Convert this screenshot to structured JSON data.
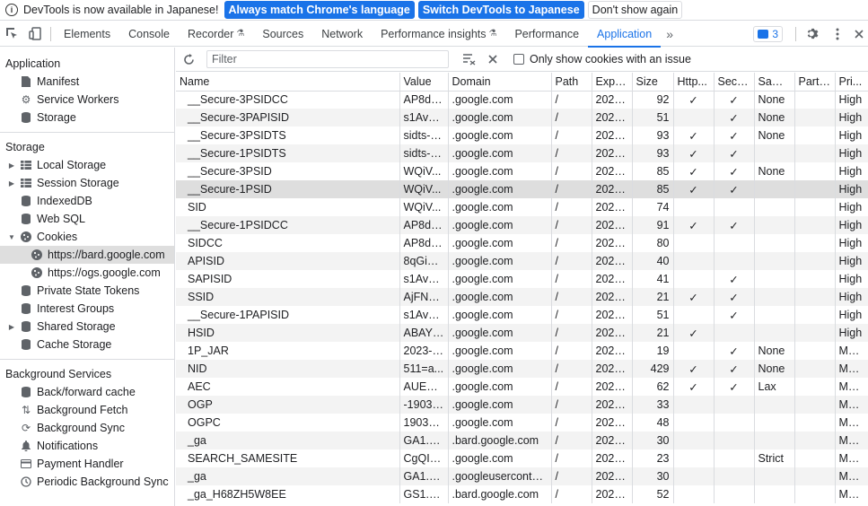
{
  "infobar": {
    "message": "DevTools is now available in Japanese!",
    "match_btn": "Always match Chrome's language",
    "switch_btn": "Switch DevTools to Japanese",
    "dismiss_btn": "Don't show again"
  },
  "tabs": [
    {
      "label": "Elements"
    },
    {
      "label": "Console"
    },
    {
      "label": "Recorder"
    },
    {
      "label": "Sources"
    },
    {
      "label": "Network"
    },
    {
      "label": "Performance insights"
    },
    {
      "label": "Performance"
    },
    {
      "label": "Application"
    }
  ],
  "issues_count": "3",
  "sidebar": {
    "application_header": "Application",
    "application_items": [
      "Manifest",
      "Service Workers",
      "Storage"
    ],
    "storage_header": "Storage",
    "storage_items": [
      "Local Storage",
      "Session Storage",
      "IndexedDB",
      "Web SQL",
      "Cookies"
    ],
    "cookie_sites": [
      "https://bard.google.com",
      "https://ogs.google.com"
    ],
    "storage_items_2": [
      "Private State Tokens",
      "Interest Groups",
      "Shared Storage",
      "Cache Storage"
    ],
    "bg_header": "Background Services",
    "bg_items": [
      "Back/forward cache",
      "Background Fetch",
      "Background Sync",
      "Notifications",
      "Payment Handler",
      "Periodic Background Sync"
    ]
  },
  "toolbar": {
    "filter_placeholder": "Filter",
    "only_issue_label": "Only show cookies with an issue"
  },
  "columns": [
    "Name",
    "Value",
    "Domain",
    "Path",
    "Expir...",
    "Size",
    "Http...",
    "Secure",
    "Sam...",
    "Parti...",
    "Pri..."
  ],
  "rows": [
    [
      "__Secure-3PSIDCC",
      "AP8dLt...",
      ".google.com",
      "/",
      "2024...",
      "92",
      "✓",
      "✓",
      "None",
      "",
      "High"
    ],
    [
      "__Secure-3PAPISID",
      "s1AvCj...",
      ".google.com",
      "/",
      "2024...",
      "51",
      "",
      "✓",
      "None",
      "",
      "High"
    ],
    [
      "__Secure-3PSIDTS",
      "sidts-C...",
      ".google.com",
      "/",
      "2024...",
      "93",
      "✓",
      "✓",
      "None",
      "",
      "High"
    ],
    [
      "__Secure-1PSIDTS",
      "sidts-C...",
      ".google.com",
      "/",
      "2024...",
      "93",
      "✓",
      "✓",
      "",
      "",
      "High"
    ],
    [
      "__Secure-3PSID",
      "WQiV...",
      ".google.com",
      "/",
      "2024...",
      "85",
      "✓",
      "✓",
      "None",
      "",
      "High"
    ],
    [
      "__Secure-1PSID",
      "WQiV...",
      ".google.com",
      "/",
      "2024...",
      "85",
      "✓",
      "✓",
      "",
      "",
      "High"
    ],
    [
      "SID",
      "WQiV...",
      ".google.com",
      "/",
      "2024...",
      "74",
      "",
      "",
      "",
      "",
      "High"
    ],
    [
      "__Secure-1PSIDCC",
      "AP8dLt...",
      ".google.com",
      "/",
      "2024...",
      "91",
      "✓",
      "✓",
      "",
      "",
      "High"
    ],
    [
      "SIDCC",
      "AP8dLt...",
      ".google.com",
      "/",
      "2024...",
      "80",
      "",
      "",
      "",
      "",
      "High"
    ],
    [
      "APISID",
      "8qGiob...",
      ".google.com",
      "/",
      "2024...",
      "40",
      "",
      "",
      "",
      "",
      "High"
    ],
    [
      "SAPISID",
      "s1AvCj...",
      ".google.com",
      "/",
      "2024...",
      "41",
      "",
      "✓",
      "",
      "",
      "High"
    ],
    [
      "SSID",
      "AjFNZ...",
      ".google.com",
      "/",
      "2024...",
      "21",
      "✓",
      "✓",
      "",
      "",
      "High"
    ],
    [
      "__Secure-1PAPISID",
      "s1AvCj...",
      ".google.com",
      "/",
      "2024...",
      "51",
      "",
      "✓",
      "",
      "",
      "High"
    ],
    [
      "HSID",
      "ABAYrr...",
      ".google.com",
      "/",
      "2024...",
      "21",
      "✓",
      "",
      "",
      "",
      "High"
    ],
    [
      "1P_JAR",
      "2023-0...",
      ".google.com",
      "/",
      "2023...",
      "19",
      "",
      "✓",
      "None",
      "",
      "Medi..."
    ],
    [
      "NID",
      "511=a...",
      ".google.com",
      "/",
      "2023...",
      "429",
      "✓",
      "✓",
      "None",
      "",
      "Medi..."
    ],
    [
      "AEC",
      "AUEFq...",
      ".google.com",
      "/",
      "2023...",
      "62",
      "✓",
      "✓",
      "Lax",
      "",
      "Medi..."
    ],
    [
      "OGP",
      "-19034...",
      ".google.com",
      "/",
      "2023...",
      "33",
      "",
      "",
      "",
      "",
      "Medi..."
    ],
    [
      "OGPC",
      "190343...",
      ".google.com",
      "/",
      "2023...",
      "48",
      "",
      "",
      "",
      "",
      "Medi..."
    ],
    [
      "_ga",
      "GA1.1....",
      ".bard.google.com",
      "/",
      "2024...",
      "30",
      "",
      "",
      "",
      "",
      "Medi..."
    ],
    [
      "SEARCH_SAMESITE",
      "CgQIm...",
      ".google.com",
      "/",
      "2023...",
      "23",
      "",
      "",
      "Strict",
      "",
      "Medi..."
    ],
    [
      "_ga",
      "GA1.2....",
      ".googleuserconte...",
      "/",
      "2024...",
      "30",
      "",
      "",
      "",
      "",
      "Medi..."
    ],
    [
      "_ga_H68ZH5W8EE",
      "GS1.1....",
      ".bard.google.com",
      "/",
      "2024...",
      "52",
      "",
      "",
      "",
      "",
      "Medi..."
    ]
  ],
  "selected_row": 5
}
